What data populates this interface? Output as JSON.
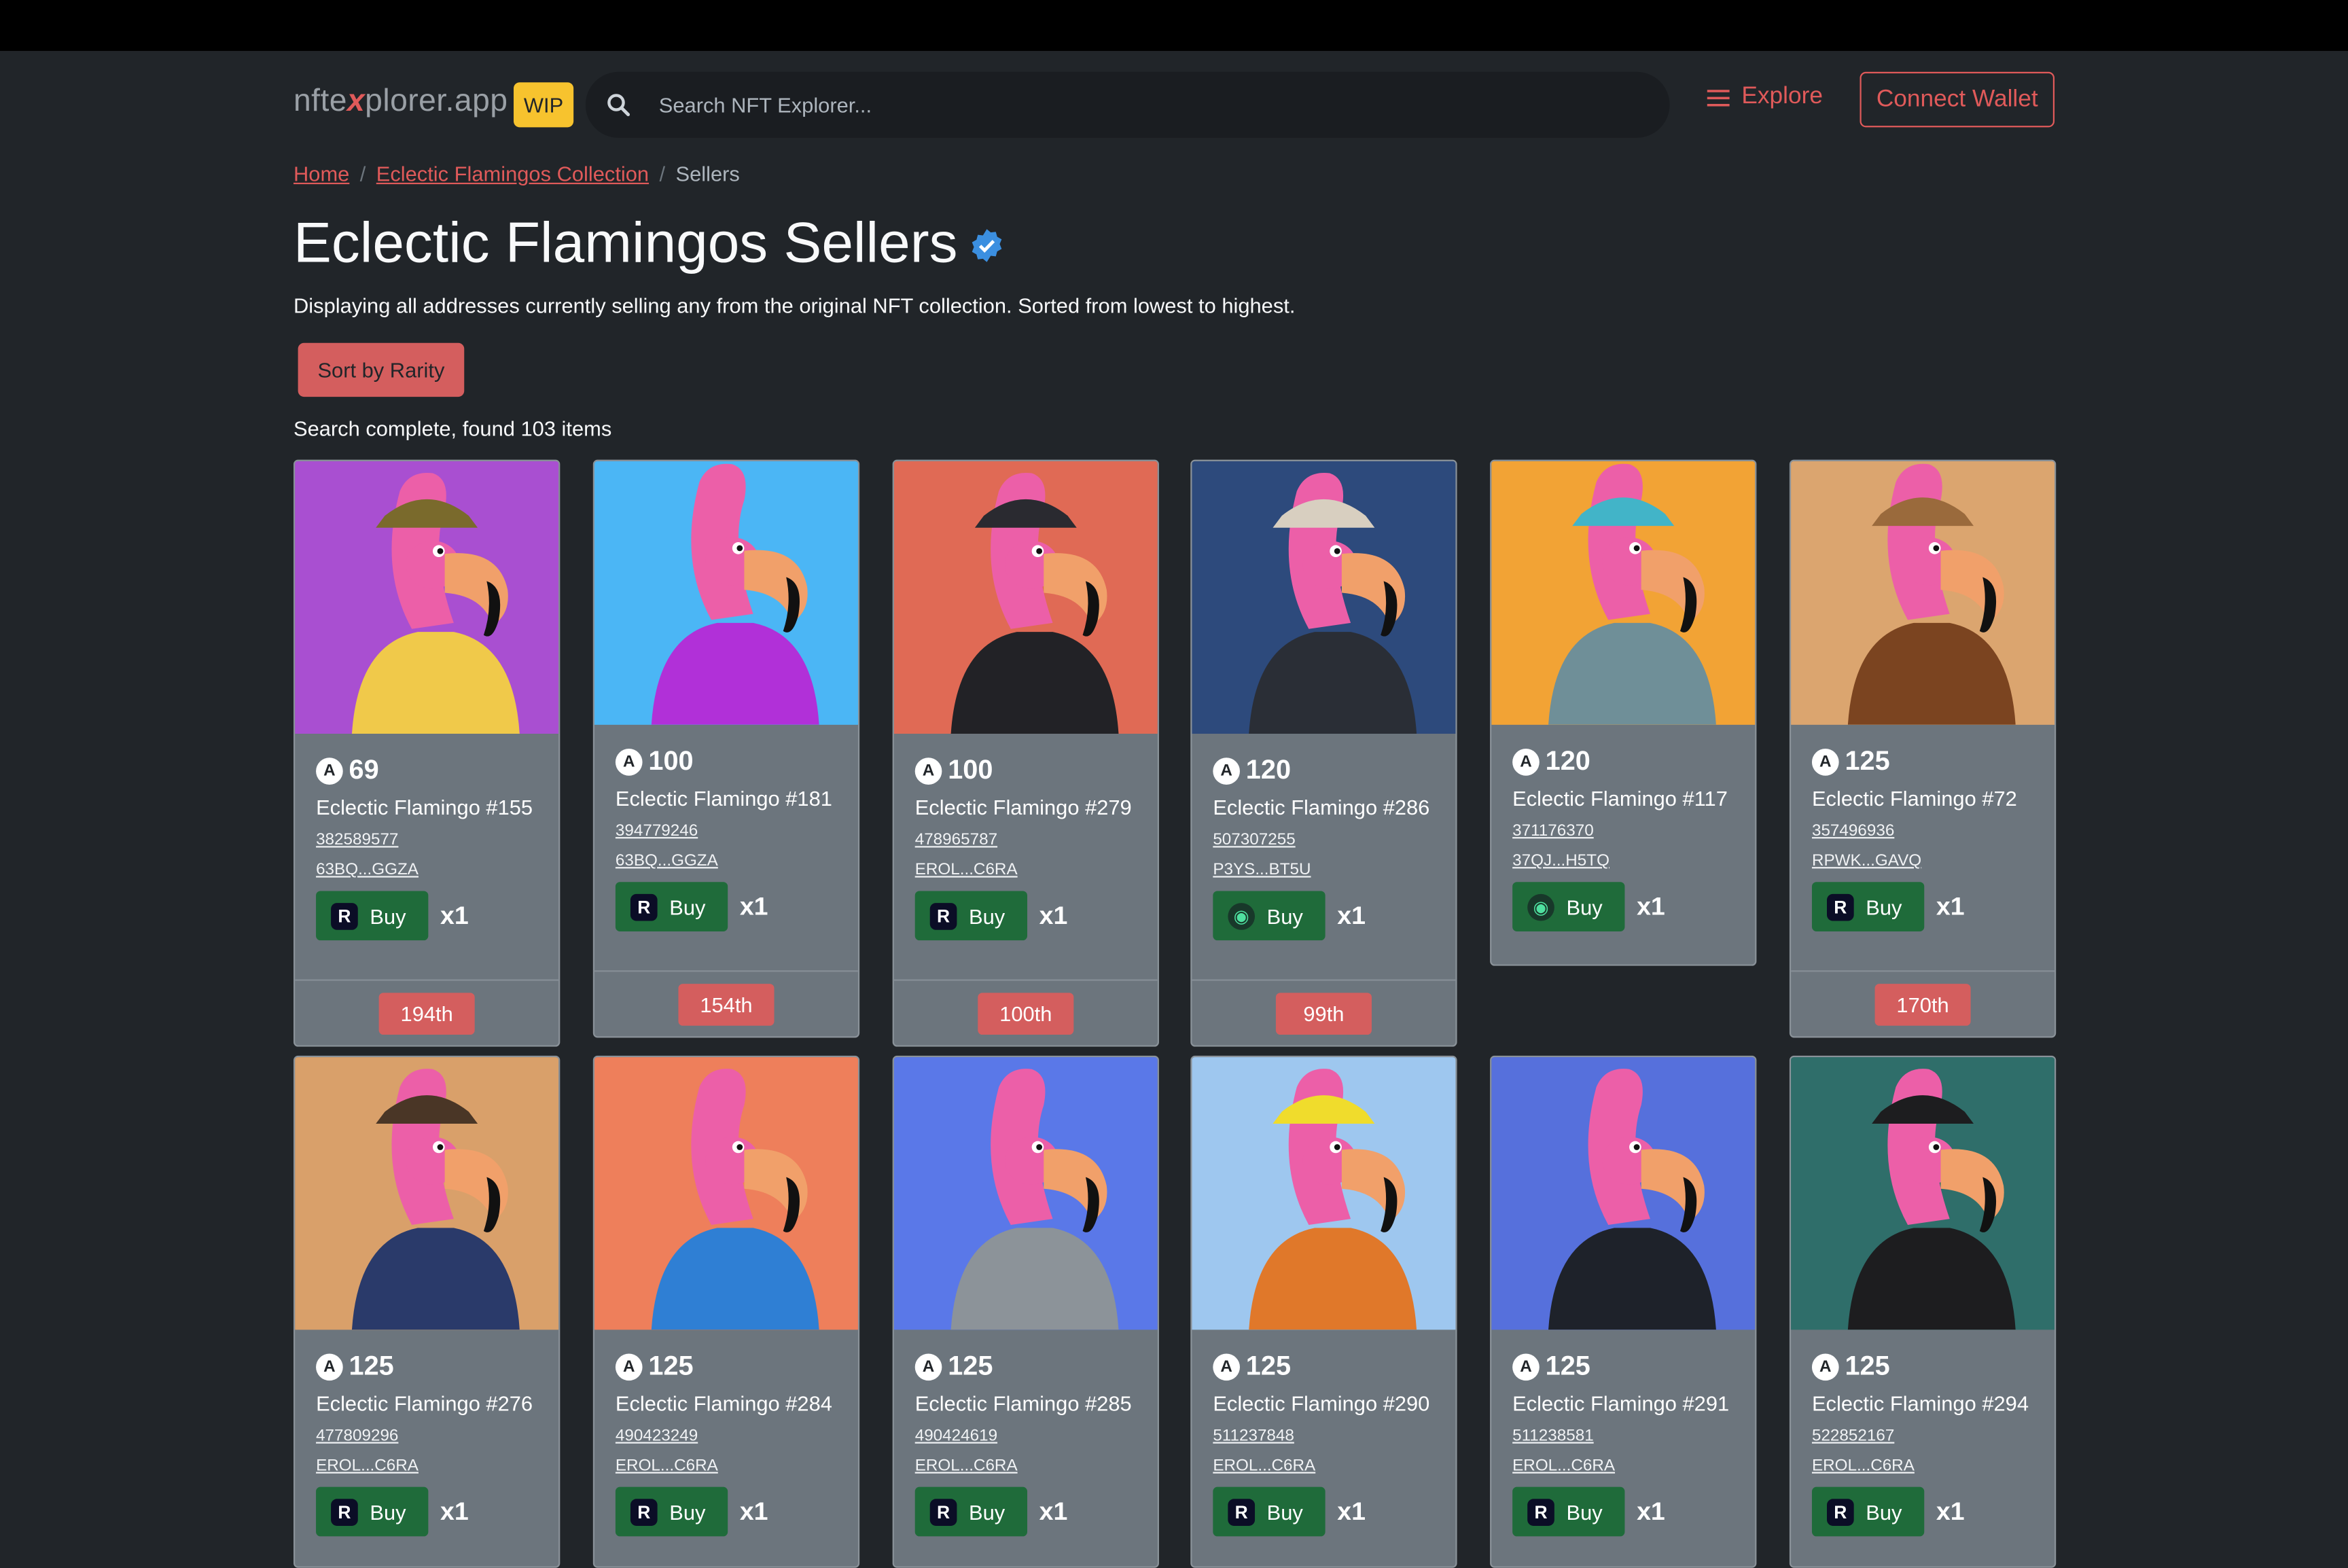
{
  "nav": {
    "brand_pre": "nfte",
    "brand_x": "x",
    "brand_post": "plorer.app",
    "wip": "WIP",
    "search_placeholder": "Search NFT Explorer...",
    "explore": "Explore",
    "connect": "Connect Wallet"
  },
  "breadcrumb": {
    "home": "Home",
    "collection": "Eclectic Flamingos Collection",
    "current": "Sellers"
  },
  "page": {
    "title": "Eclectic Flamingos Sellers",
    "description": "Displaying all addresses currently selling any from the original NFT collection. Sorted from lowest to highest.",
    "sort_button": "Sort by Rarity",
    "status": "Search complete, found 103 items"
  },
  "colors": {
    "accent": "#e05a5a",
    "buy": "#1f6b3a",
    "background": "#212529",
    "card": "#6c757d"
  },
  "cards": [
    {
      "price": "69",
      "name": "Eclectic Flamingo #155",
      "id": "382589577",
      "seller": "63BQ...GGZA",
      "market": "R",
      "buy": "Buy",
      "qty": "x1",
      "rank": "194th",
      "bg": "#a94fd1",
      "shirt": "#f0c94a",
      "hat": "#7a6a2c"
    },
    {
      "price": "100",
      "name": "Eclectic Flamingo #181",
      "id": "394779246",
      "seller": "63BQ...GGZA",
      "market": "R",
      "buy": "Buy",
      "qty": "x1",
      "rank": "154th",
      "bg": "#4bb6f5",
      "shirt": "#b130d8",
      "hat": ""
    },
    {
      "price": "100",
      "name": "Eclectic Flamingo #279",
      "id": "478965787",
      "seller": "EROL...C6RA",
      "market": "R",
      "buy": "Buy",
      "qty": "x1",
      "rank": "100th",
      "bg": "#e06a55",
      "shirt": "#222226",
      "hat": "#2a2a30"
    },
    {
      "price": "120",
      "name": "Eclectic Flamingo #286",
      "id": "507307255",
      "seller": "P3YS...BT5U",
      "market": "G",
      "buy": "Buy",
      "qty": "x1",
      "rank": "99th",
      "bg": "#2d4a7c",
      "shirt": "#2a2e36",
      "hat": "#d8cfc0"
    },
    {
      "price": "120",
      "name": "Eclectic Flamingo #117",
      "id": "371176370",
      "seller": "37QJ...H5TQ",
      "market": "G",
      "buy": "Buy",
      "qty": "x1",
      "rank": "",
      "bg": "#f2a335",
      "shirt": "#6f8f98",
      "hat": "#42b4c8"
    },
    {
      "price": "125",
      "name": "Eclectic Flamingo #72",
      "id": "357496936",
      "seller": "RPWK...GAVQ",
      "market": "R",
      "buy": "Buy",
      "qty": "x1",
      "rank": "170th",
      "bg": "#dba56f",
      "shirt": "#7b4420",
      "hat": "#9a6a3c"
    },
    {
      "price": "125",
      "name": "Eclectic Flamingo #276",
      "id": "477809296",
      "seller": "EROL...C6RA",
      "market": "R",
      "buy": "Buy",
      "qty": "x1",
      "rank": "",
      "bg": "#d9a06a",
      "shirt": "#2a3a6a",
      "hat": "#4a3626"
    },
    {
      "price": "125",
      "name": "Eclectic Flamingo #284",
      "id": "490423249",
      "seller": "EROL...C6RA",
      "market": "R",
      "buy": "Buy",
      "qty": "x1",
      "rank": "",
      "bg": "#ee7f5b",
      "shirt": "#2f7fd4",
      "hat": ""
    },
    {
      "price": "125",
      "name": "Eclectic Flamingo #285",
      "id": "490424619",
      "seller": "EROL...C6RA",
      "market": "R",
      "buy": "Buy",
      "qty": "x1",
      "rank": "",
      "bg": "#5a78e8",
      "shirt": "#8c9399",
      "hat": ""
    },
    {
      "price": "125",
      "name": "Eclectic Flamingo #290",
      "id": "511237848",
      "seller": "EROL...C6RA",
      "market": "R",
      "buy": "Buy",
      "qty": "x1",
      "rank": "",
      "bg": "#9ec7ef",
      "shirt": "#e0782a",
      "hat": "#f0dc2c"
    },
    {
      "price": "125",
      "name": "Eclectic Flamingo #291",
      "id": "511238581",
      "seller": "EROL...C6RA",
      "market": "R",
      "buy": "Buy",
      "qty": "x1",
      "rank": "",
      "bg": "#5670dc",
      "shirt": "#1e222a",
      "hat": ""
    },
    {
      "price": "125",
      "name": "Eclectic Flamingo #294",
      "id": "522852167",
      "seller": "EROL...C6RA",
      "market": "R",
      "buy": "Buy",
      "qty": "x1",
      "rank": "",
      "bg": "#2f6e6a",
      "shirt": "#1d1d1f",
      "hat": "#1d1d1f"
    }
  ]
}
